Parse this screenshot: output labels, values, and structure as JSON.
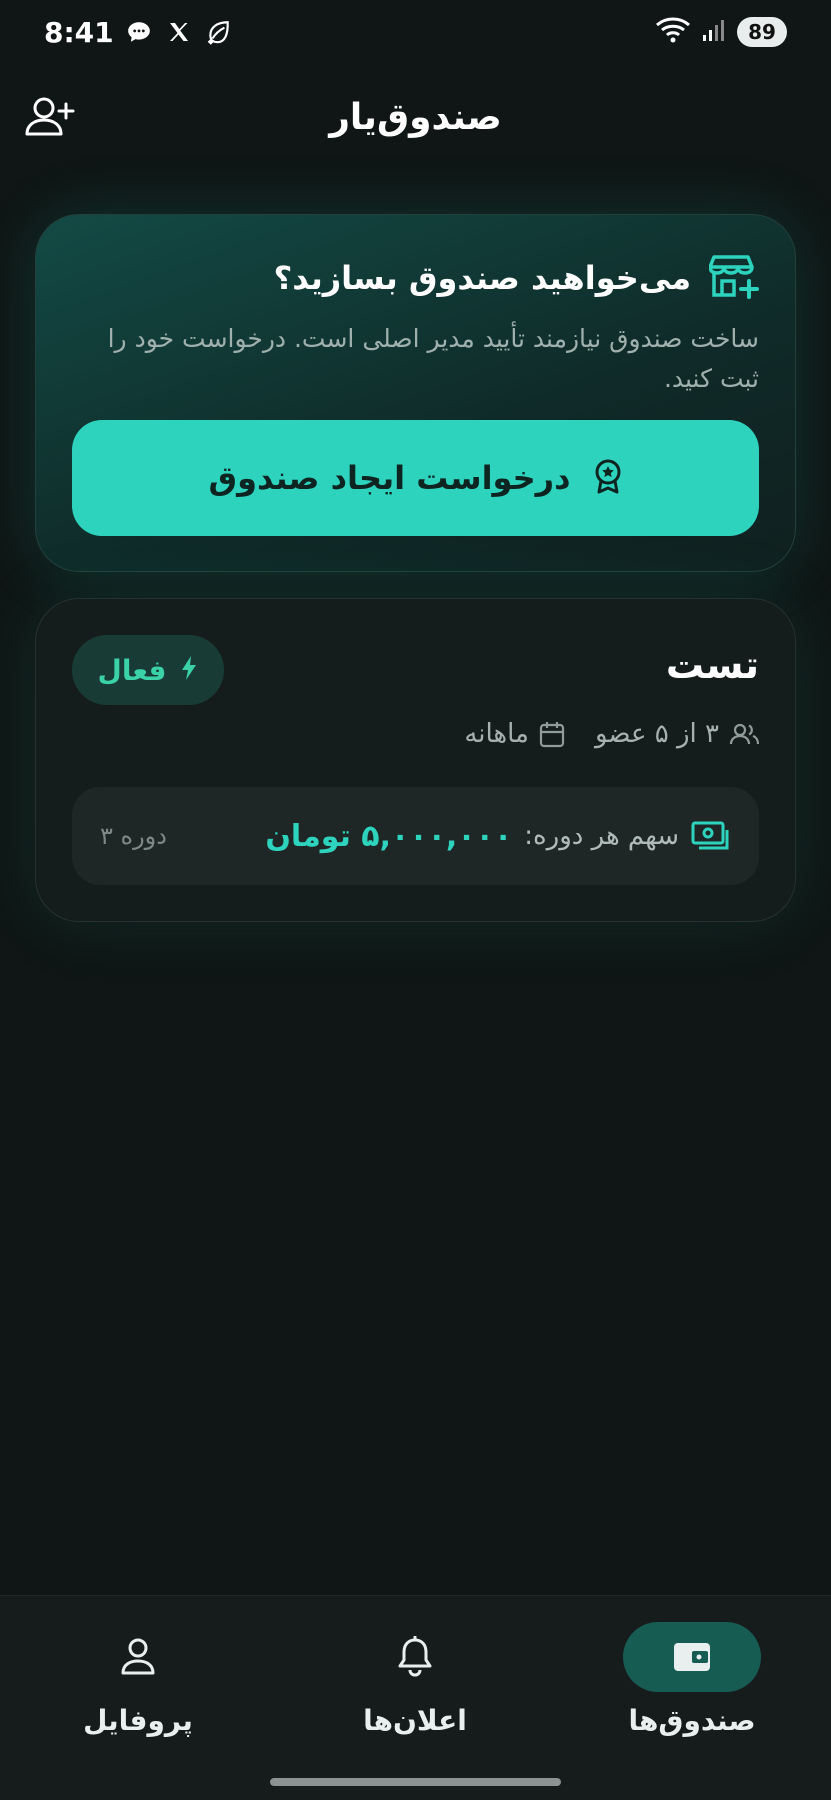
{
  "status_bar": {
    "time": "8:41",
    "battery": "89"
  },
  "header": {
    "title": "صندوق‌یار"
  },
  "cta": {
    "title": "می‌خواهید صندوق بسازید؟",
    "description": "ساخت صندوق نیازمند تأیید مدیر اصلی است. درخواست خود را ثبت کنید.",
    "button_label": "درخواست ایجاد صندوق"
  },
  "fund": {
    "name": "تست",
    "status": "فعال",
    "members": "۳ از ۵ عضو",
    "frequency": "ماهانه",
    "share_label": "سهم هر دوره:",
    "share_amount": "۵,۰۰۰,۰۰۰ تومان",
    "period": "دوره ۳"
  },
  "nav": {
    "funds": "صندوق‌ها",
    "notifications": "اعلان‌ها",
    "profile": "پروفایل"
  },
  "colors": {
    "accent": "#2ed3be",
    "background": "#0f1615",
    "active_status": "#3bd2a8"
  }
}
